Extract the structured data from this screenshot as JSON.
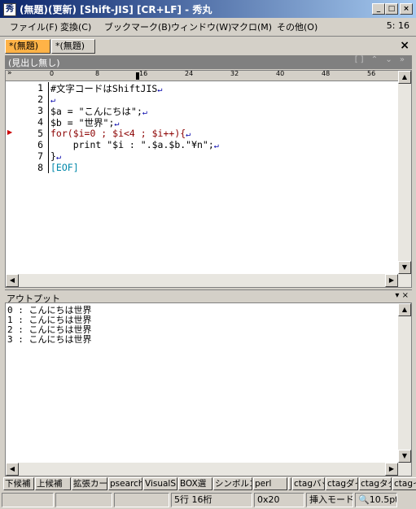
{
  "window": {
    "app_icon": "秀",
    "title": "(無題)(更新) [Shift-JIS] [CR+LF] - 秀丸",
    "minimize_glyph": "_",
    "maximize_glyph": "□",
    "close_glyph": "×"
  },
  "menu": {
    "items": [
      "ファイル(F)",
      "変換(C)",
      "ブックマーク(B)",
      "ウィンドウ(W)",
      "マクロ(M)",
      "その他(O)"
    ],
    "cursor_position": "5: 16"
  },
  "tabs": {
    "items": [
      "*(無題)",
      "*(無題)"
    ],
    "close_glyph": "×"
  },
  "heading_bar": {
    "label": "(見出し無し)",
    "controls": "[] ⌃ ⌄ »"
  },
  "ruler": {
    "chevron": "»",
    "marks": [
      "0",
      "8",
      "16",
      "24",
      "32",
      "40",
      "48",
      "56"
    ]
  },
  "editor": {
    "lines": [
      {
        "num": "1",
        "text": "#文字コードはShiftJIS",
        "color": "#000000",
        "nl": "↵"
      },
      {
        "num": "2",
        "text": "",
        "color": "#000000",
        "nl": "↵"
      },
      {
        "num": "3",
        "text": "$a = \"こんにちは\";",
        "color": "#000000",
        "nl": "↵"
      },
      {
        "num": "4",
        "text": "$b = \"世界\";",
        "color": "#000000",
        "nl": "↵"
      },
      {
        "num": "5",
        "text": "for($i=0 ; $i<4 ; $i++){",
        "color": "#8b0000",
        "nl": "↵"
      },
      {
        "num": "6",
        "text": "    print \"$i : \".$a.$b.\"¥n\";",
        "color": "#000000",
        "nl": "↵"
      },
      {
        "num": "7",
        "text": "}",
        "color": "#000000",
        "nl": "↵"
      },
      {
        "num": "8",
        "text": "[EOF]",
        "color": "#0088aa",
        "nl": ""
      }
    ]
  },
  "output_panel": {
    "title": "アウトプット",
    "controls": "▾ ×",
    "lines": [
      "0 : こんにちは世界",
      "1 : こんにちは世界",
      "2 : こんにちは世界",
      "3 : こんにちは世界"
    ]
  },
  "toolbar": {
    "buttons": [
      "下候補",
      "上候補",
      "拡張カー",
      "psearch",
      "VisualS",
      "BOX選",
      "シンボルコ",
      "perl",
      "",
      "ctagバッ",
      "ctagダイ",
      "ctagタグ",
      "ctagインフ"
    ]
  },
  "status": {
    "line_col": "5行 16桁",
    "char_code": "0x20",
    "mode": "挿入モード",
    "font_size": "10.5pt"
  }
}
